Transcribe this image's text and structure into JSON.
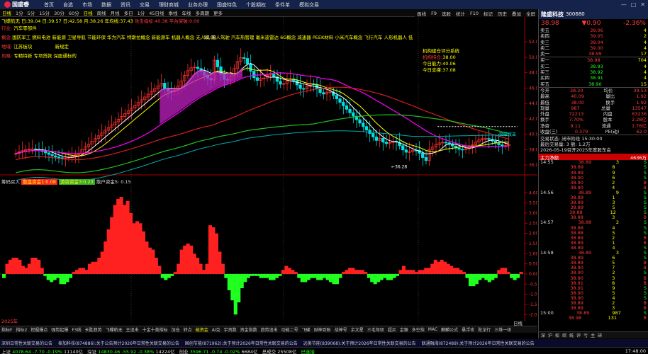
{
  "app": {
    "logo": "国盛睿",
    "window_controls": [
      "—",
      "□",
      "✕"
    ]
  },
  "menu": [
    "首页",
    "自选",
    "市场",
    "数据",
    "资讯",
    "交易",
    "理财商城",
    "业务办理",
    "国盛特色",
    "个股期权",
    "条件单",
    "模拟交易"
  ],
  "toolbar": [
    "日线",
    "1分",
    "5分",
    "15分",
    "30分",
    "60分",
    "日线",
    "周线",
    "月线",
    "多日",
    "1分",
    "45日线",
    "季线",
    "年线",
    "多周期",
    "更多"
  ],
  "toolbar_right": [
    "画线",
    "F9",
    "选股",
    "统计",
    "F10",
    "标记",
    "历史",
    "叠加",
    "全屏"
  ],
  "stock": {
    "name": "隆盛科技",
    "code": "300680",
    "price": "38.98",
    "change": "▼0.90",
    "pct": "-2.36%"
  },
  "chart_header": {
    "ma": "飞蝶航无 日:39.04 日:39.57 日:42.58 月:38.26 年均线:37.43 ",
    "right": "攻击指标:40.38 平台突破:0.00"
  },
  "info_lines": [
    {
      "label": "行业:",
      "text": "汽车零部件"
    },
    {
      "label": "概念:",
      "text": "国防军工 燃料电池 新能源 卫星导航 节能环保 华为汽车 特斯拉概念 新能源车 机器人概念 无人机 无人驾驶 汽车热管理 毫米波雷达 6G概念 减速器 PEEK材料 小米汽车概念 飞行汽车 人形机器人 低空经济 商业航天"
    },
    {
      "label": "地域:",
      "text": "江苏板块"
    },
    {
      "label": "风格:",
      "text": "专精特新 专项贷款 深股通标的"
    }
  ],
  "flag": "新规定",
  "yinfo": {
    "title": "机构建仓评分系统",
    "items": [
      {
        "k": "机构持仓:",
        "v": "38.00"
      },
      {
        "k": "今日能力:",
        "v": "40.06"
      },
      {
        "k": "今日支撑:",
        "v": "37.08"
      }
    ]
  },
  "price_labels": [
    "52.00",
    "50.00",
    "48.00",
    "46.00",
    "44.00",
    "42.00",
    "40.00",
    "38.00",
    "36.00"
  ],
  "annotations": {
    "high": "52.08",
    "low": "36.28",
    "breakout": "突破攻击"
  },
  "lower_header": {
    "title": "筹码买入",
    "a": "散盘资金1:0.08",
    "b": "游资资金3:0.23",
    "c": "散户资金5: 0.15"
  },
  "lower_labels": [
    "4.00",
    "3.50",
    "3.00",
    "2.50",
    "2.00",
    "1.50",
    "1.00",
    "0.50",
    "0.00",
    "-0.50",
    "-1.00",
    "-1.50",
    "-2.00"
  ],
  "chart_data": {
    "type": "bar",
    "title": "",
    "ylim": [
      -2.2,
      4.5
    ],
    "values": [
      -0.2,
      0.5,
      0.7,
      0.8,
      0.8,
      0.7,
      0.4,
      0.3,
      0.5,
      0.8,
      0.8,
      0.7,
      0.3,
      -0.1,
      -0.3,
      -0.4,
      -0.3,
      -0.2,
      -0.5,
      -0.5,
      -0.4,
      -0.2,
      0.1,
      0.2,
      0.3,
      0.3,
      0.2,
      0.5,
      0.6,
      0.6,
      0.8,
      1.1,
      1.6,
      2.2,
      2.8,
      3.4,
      3.7,
      3.8,
      3.4,
      3.6,
      3.0,
      2.5,
      2.6,
      2.5,
      2.1,
      1.6,
      1.3,
      1.2,
      0.8,
      0.4,
      -0.2,
      -0.3,
      -0.2,
      -0.1,
      0.1,
      0.5,
      1.2,
      1.4,
      1.5,
      1.4,
      1.0,
      0.8,
      0.5,
      0.2,
      0.5,
      2.4,
      2.3,
      2.0,
      1.1,
      0.5,
      -0.2,
      -0.8,
      -1.3,
      -2.0,
      -1.4,
      -0.7,
      -0.4,
      -0.2,
      -0.1,
      -0.1,
      -0.1,
      -0.2,
      -0.2,
      -0.2,
      -0.3,
      -0.3,
      -0.2,
      -0.1,
      0.2,
      0.4,
      0.3,
      0.2,
      0.1,
      -0.2,
      -0.4,
      -0.4,
      -0.3,
      -0.2,
      -0.2,
      -0.3,
      -0.3,
      -0.2,
      -0.3,
      -0.4,
      -0.5,
      -0.5,
      -0.2,
      0.1,
      0.2,
      0.3,
      0.3,
      0.2,
      0.2,
      0.2,
      0.1,
      -0.2,
      -0.4,
      -0.5,
      -0.4,
      -0.3,
      -0.2,
      -0.3,
      -0.3,
      -0.2,
      -0.1,
      0.2,
      0.4,
      0.2,
      0.2,
      0.2,
      0.1,
      0.2,
      0.2,
      0.3,
      0.3,
      0.5,
      0.7,
      0.6,
      0.7,
      0.6,
      0.5,
      0.4,
      0.3,
      0.3,
      0.2,
      0.1,
      -0.2,
      -0.6,
      -0.6,
      -0.5,
      -0.3,
      -0.2,
      -0.3,
      -0.4,
      -0.3,
      -0.2,
      0.2,
      0.3,
      0.3,
      0.1,
      -0.2,
      -0.3,
      -0.2,
      0.1
    ]
  },
  "x_label": "2025年",
  "period_label": "日线",
  "right": {
    "sells": [
      {
        "l": "卖五",
        "p": "39.06",
        "v": "4"
      },
      {
        "l": "卖四",
        "p": "39.05",
        "v": "2"
      },
      {
        "l": "卖三",
        "p": "39.04",
        "v": "4"
      },
      {
        "l": "卖二",
        "p": "39.00",
        "v": "4"
      },
      {
        "l": "卖一",
        "p": "38.99",
        "v": "17"
      }
    ],
    "buys": [
      {
        "l": "买一",
        "p": "38.98",
        "v": "704"
      },
      {
        "l": "买二",
        "p": "38.93",
        "v": "4"
      },
      {
        "l": "买三",
        "p": "38.92",
        "v": "4"
      },
      {
        "l": "买四",
        "p": "38.91",
        "v": "4"
      },
      {
        "l": "买五",
        "p": "38.90",
        "v": "15"
      }
    ],
    "stats": [
      {
        "a": "今开",
        "b": "38.20",
        "c": "均价",
        "d": "39.53"
      },
      {
        "a": "最高",
        "b": "40.09",
        "c": "量比",
        "d": "1.92"
      },
      {
        "a": "最低",
        "b": "38.00",
        "c": "换手",
        "d": "1.92"
      },
      {
        "a": "现量",
        "b": "987",
        "c": "总量",
        "d": "13547"
      },
      {
        "a": "外盘",
        "b": "72213",
        "c": "内盘",
        "d": "63236"
      },
      {
        "a": "换手",
        "b": "7.70%",
        "c": "股本",
        "d": "2.28亿"
      },
      {
        "a": "净资",
        "b": "9.11",
        "c": "流通",
        "d": "1.76亿"
      },
      {
        "a": "收益(三)",
        "b": "0.379",
        "c": "PE(动)",
        "d": "62.0"
      }
    ],
    "state": "交易状态: 闭市阶段 15:30:00",
    "last": "最后交易量: 3  额: 1.2万",
    "notice": "2026-05-19召开2025年度股东会",
    "flow_title": "主力净额",
    "flow_val": "4636万",
    "ticks": [
      {
        "t": "14:55",
        "p": "38.89",
        "v": "3",
        "d": "S"
      },
      {
        "t": "",
        "p": "38.89",
        "v": "8",
        "d": "S"
      },
      {
        "t": "",
        "p": "38.89",
        "v": "9",
        "d": "S"
      },
      {
        "t": "",
        "p": "38.90",
        "v": "6",
        "d": "S"
      },
      {
        "t": "",
        "p": "38.90",
        "v": "2",
        "d": "B"
      },
      {
        "t": "",
        "p": "38.90",
        "v": "4",
        "d": "B"
      },
      {
        "t": "14:56",
        "p": "38.89",
        "v": "9",
        "d": "S"
      },
      {
        "t": "",
        "p": "38.89",
        "v": "1",
        "d": "S"
      },
      {
        "t": "",
        "p": "38.89",
        "v": "3",
        "d": "S"
      },
      {
        "t": "",
        "p": "38.89",
        "v": "5",
        "d": "S"
      },
      {
        "t": "",
        "p": "38.88",
        "v": "12",
        "d": "S"
      },
      {
        "t": "",
        "p": "38.88",
        "v": "3",
        "d": "B"
      },
      {
        "t": "14:57",
        "p": "38.88",
        "v": "2",
        "d": "S"
      },
      {
        "t": "",
        "p": "38.88",
        "v": "4",
        "d": "S"
      },
      {
        "t": "",
        "p": "38.88",
        "v": "5",
        "d": "S"
      },
      {
        "t": "",
        "p": "38.89",
        "v": "2",
        "d": "B"
      },
      {
        "t": "",
        "p": "38.89",
        "v": "1",
        "d": "B"
      },
      {
        "t": "",
        "p": "38.89",
        "v": "4",
        "d": "S"
      },
      {
        "t": "14:58",
        "p": "38.89",
        "v": "3",
        "d": "S"
      },
      {
        "t": "",
        "p": "38.89",
        "v": "6",
        "d": "S"
      },
      {
        "t": "",
        "p": "38.89",
        "v": "5",
        "d": "B"
      },
      {
        "t": "",
        "p": "38.90",
        "v": "7",
        "d": "B"
      },
      {
        "t": "",
        "p": "38.90",
        "v": "2",
        "d": "S"
      },
      {
        "t": "",
        "p": "38.90",
        "v": "3",
        "d": "B"
      },
      {
        "t": "",
        "p": "38.91",
        "v": "8",
        "d": "B"
      },
      {
        "t": "",
        "p": "38.91",
        "v": "9",
        "d": "S"
      },
      {
        "t": "",
        "p": "38.90",
        "v": "5",
        "d": "S"
      },
      {
        "t": "",
        "p": "38.90",
        "v": "4",
        "d": "S"
      },
      {
        "t": "",
        "p": "38.89",
        "v": "2",
        "d": "B"
      },
      {
        "t": "",
        "p": "38.89",
        "v": "3",
        "d": "B"
      },
      {
        "t": "15:00",
        "p": "38.89",
        "v": "987",
        "d": "S"
      },
      {
        "t": "",
        "p": "38.98",
        "v": "131",
        "d": "B"
      }
    ],
    "bottom_tabs": [
      "深",
      "沪",
      "权",
      "综",
      "统",
      "评",
      "亏",
      "主",
      "研"
    ]
  },
  "bottom_tabs": [
    "指标F",
    "指标2",
    "挖掘爆点",
    "强势起爆",
    "F3线",
    "长胜趋势",
    "飞蝶航无",
    "主追击",
    "十金十美指标",
    "加仓",
    "转点",
    "能资金",
    "AI克",
    "宇资数",
    "资金指数",
    "趋势追击",
    "动能二号",
    "飞碟",
    "财神到账",
    "战神号",
    "余文星",
    "三毛驾驭",
    "超买",
    "金猴",
    "多空指",
    "MAC",
    "麒麟公式",
    "悬浮攻",
    "驼龙行",
    "三维一体"
  ],
  "ticker": [
    "深圳日常性关联交易的公告",
    "奉加科技(874886):关于公告预计2026年日常性关联交易的公告",
    "国创节能(871962):关于预计2026年日常性关联交易的公告",
    "远美节能(839068):关于预计2026年日常性关联交易的公告",
    "联通融海(872489):关于预计2026年日常性关联交易的公告"
  ],
  "status": [
    {
      "k": "上证",
      "v": "4078.64",
      "c": "-7.70",
      "p": "-0.19%",
      "a": "11140亿"
    },
    {
      "k": "深证",
      "v": "14830.46",
      "c": "-55.92",
      "p": "-0.38%",
      "a": "14224亿"
    },
    {
      "k": "创业",
      "v": "3596.71",
      "c": "-0.74",
      "p": "-0.02%",
      "a": "6684亿"
    }
  ],
  "status_total": "总成交 25508亿",
  "status_conn": "已连接",
  "clock": "17:48:00"
}
